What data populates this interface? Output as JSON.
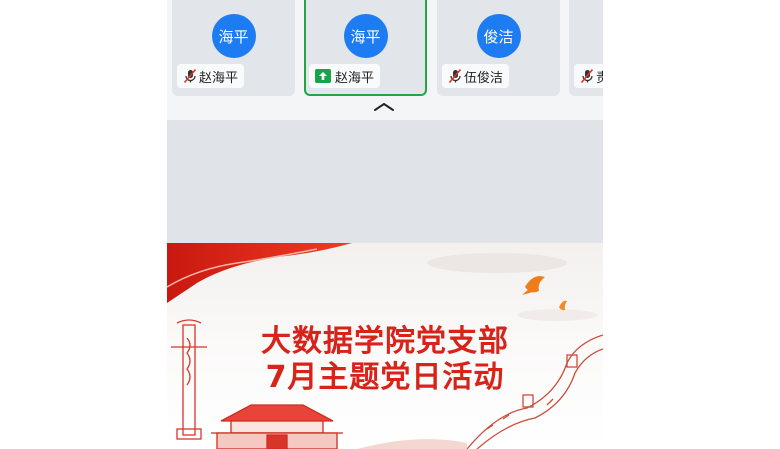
{
  "participants": [
    {
      "avatar_text": "海平",
      "name": "赵海平",
      "status_icon": "mic-off-icon",
      "active": false
    },
    {
      "avatar_text": "海平",
      "name": "赵海平",
      "status_icon": "screen-share-icon",
      "active": true
    },
    {
      "avatar_text": "俊洁",
      "name": "伍俊洁",
      "status_icon": "mic-off-icon",
      "active": false
    },
    {
      "avatar_text": "",
      "name": "责",
      "status_icon": "mic-off-icon",
      "active": false
    }
  ],
  "collapse_icon": "chevron-up-icon",
  "slide": {
    "title_line1": "大数据学院党支部",
    "title_line2": "7月主题党日活动"
  },
  "colors": {
    "avatar": "#1e7cf2",
    "active_border": "#22a447",
    "slide_title": "#d8231b",
    "tile_bg": "#e2e5ea"
  }
}
